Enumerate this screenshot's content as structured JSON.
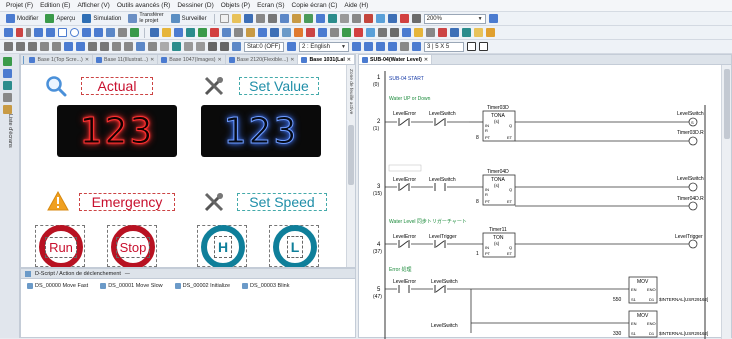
{
  "menubar": [
    "Projet (F)",
    "Edition (E)",
    "Afficher (V)",
    "Outils avancés (R)",
    "Dessiner (D)",
    "Objets (P)",
    "Ecran (S)",
    "Copie écran (C)",
    "Aide (H)"
  ],
  "toolbar1": {
    "modifier": "Modifier",
    "apercu": "Aperçu",
    "simulation": "Simulation",
    "transferer_l1": "Transférer",
    "transferer_l2": "le projet",
    "surveiller": "Surveiller",
    "zoom": "200%"
  },
  "toolbar3": {
    "state": "Stat:0 (OFF)",
    "language": "2 : English",
    "grid": "3 | 5 X 5"
  },
  "leftdock": {
    "vertical_label": "Liste d'écrans"
  },
  "screen_tabs": [
    "Base 1(Top Scre...)",
    "Base 11(Illustrat...)",
    "Base 1047(Images)",
    "Base 2120(Flexible...)",
    "Base 1031(Lal"
  ],
  "screen": {
    "actual_label": "Actual",
    "set_value_label": "Set Value",
    "actual_value": "123",
    "set_value": "123",
    "emergency_label": "Emergency",
    "set_speed_label": "Set Speed",
    "run_label": "Run",
    "stop_label": "Stop",
    "h_label": "H",
    "l_label": "L",
    "side_vertical_label": "Zone de feuille active"
  },
  "colors": {
    "red": "#c8102e",
    "teal": "#1f8ea8",
    "dark_red_ring": "#b81222",
    "dark_teal_ring": "#0f7f9a"
  },
  "action_pane": {
    "header": "D-Script / Action de déclenchement",
    "items": [
      "DS_00000 Move Fast",
      "DS_00001 Move Slow",
      "DS_00002 Initialize",
      "DS_00003 Blink"
    ]
  },
  "ladder_tab": "SUB-04(Water Level)",
  "ladder": {
    "rung1": {
      "num": "1",
      "step": "(0)",
      "text": "SUB-04 START"
    },
    "comment2": "Water UP or Down",
    "rung2": {
      "num": "2",
      "step": "(1)",
      "c1": "LevelError",
      "c2": "LevelSwitch",
      "timer_name": "Timer03D",
      "timer_type": "TONA",
      "timer_x": "(s)",
      "timer_k": "8",
      "coil": "LevelSwitch",
      "coil2": "Timer03D.R",
      "in_label": "IN",
      "q_label": "Q",
      "pt_label": "PT",
      "et_label": "ET",
      "r_label": "R"
    },
    "rung3": {
      "num": "3",
      "step": "(15)",
      "c1": "LevelError",
      "c2": "LevelSwitch",
      "timer_name": "Timer04D",
      "timer_type": "TONA",
      "timer_x": "(s)",
      "timer_k": "8",
      "coil": "LevelSwitch",
      "coil2": "Timer04D.R",
      "in_label": "IN",
      "q_label": "Q",
      "pt_label": "PT",
      "et_label": "ET",
      "r_label": "R"
    },
    "comment4": "Water Level 同步トリガーチャート",
    "rung4": {
      "num": "4",
      "step": "(37)",
      "c1": "LevelError",
      "c2": "LevelTrigger",
      "timer_name": "Timer11",
      "timer_type": "TON",
      "timer_x": "(s)",
      "timer_k": "1",
      "coil": "LevelTrigger",
      "in_label": "IN",
      "q_label": "Q",
      "pt_label": "PT",
      "et_label": "ET"
    },
    "comment5": "Error 処理",
    "rung5": {
      "num": "5",
      "step": "(47)",
      "c1": "LevelError",
      "c2": "LevelSwitch",
      "mov1_src": "550",
      "mov1_dst": "$INTERNAL[USR29162]",
      "mov2_src": "330",
      "mov2_dst": "$INTERNAL[USR29162]",
      "mov_label": "MOV",
      "en": "EN",
      "eno": "ENO",
      "s1": "S1",
      "d1": "D1",
      "c3": "LevelSwitch"
    }
  }
}
